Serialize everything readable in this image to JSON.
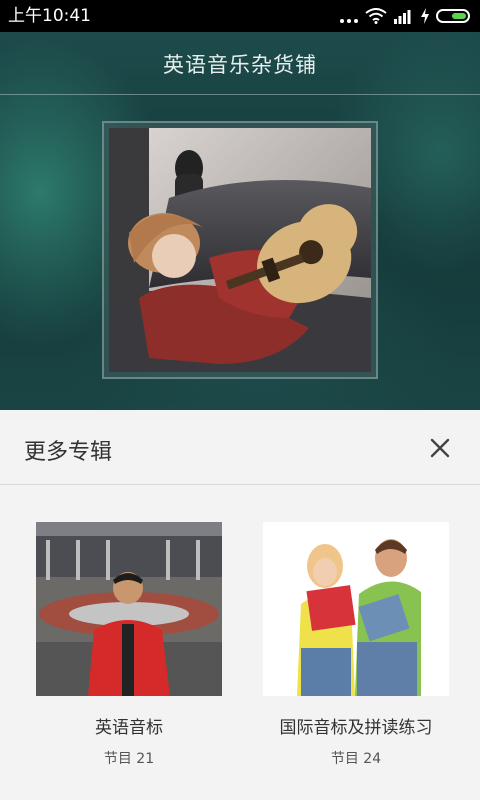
{
  "status_bar": {
    "time": "上午10:41",
    "icons": [
      "more-dots-icon",
      "wifi-icon",
      "signal-icon",
      "charging-icon",
      "battery-icon"
    ]
  },
  "header": {
    "title": "英语音乐杂货铺"
  },
  "sheet": {
    "title": "更多专辑",
    "close_icon": "close-icon",
    "albums": [
      {
        "name": "英语音标",
        "count": "节目 21"
      },
      {
        "name": "国际音标及拼读练习",
        "count": "节目 24"
      }
    ]
  },
  "colors": {
    "sheet_bg": "#f3f3f3",
    "hero_bg": "#1a4444",
    "battery": "#5bd34a"
  }
}
